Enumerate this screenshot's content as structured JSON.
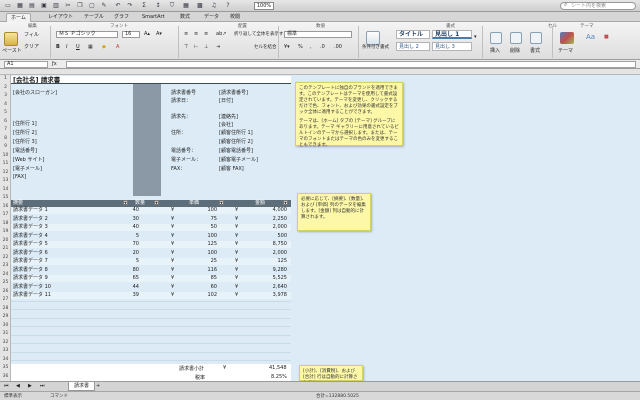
{
  "toolbar": {
    "zoom": "100%",
    "search_placeholder": "シート内を検索"
  },
  "ribbon_tabs": [
    "ホーム",
    "レイアウト",
    "テーブル",
    "グラフ",
    "SmartArt",
    "数式",
    "データ",
    "校閲"
  ],
  "ribbon": {
    "group_titles": [
      "編集",
      "フォント",
      "配置",
      "数値",
      "書式",
      "セル",
      "テーマ"
    ],
    "paste_label": "ペースト",
    "fill_label": "フィル",
    "clear_label": "クリア",
    "font_name": "ＭＳ Ｐゴシック",
    "font_size": "16",
    "wrap_label": "折り返して全体を表示する",
    "merge_label": "セルを結合",
    "number_format": "標準",
    "conditional_label": "条件付き書式",
    "style_title": "タイトル",
    "style_h1": "見出し 1",
    "style_h2": "見出し 2",
    "style_h3": "見出し 3",
    "insert_label": "挿入",
    "delete_label": "削除",
    "format_label": "書式",
    "theme_label": "テーマ",
    "aa_label": "Aa"
  },
  "formula_bar": {
    "cell_ref": "A1",
    "value": ""
  },
  "rows": [
    "1",
    "2",
    "3",
    "4",
    "5",
    "6",
    "7",
    "8",
    "9",
    "10",
    "11",
    "12",
    "13",
    "14",
    "15",
    "16",
    "17",
    "18",
    "19",
    "20",
    "21",
    "22",
    "23",
    "24",
    "25",
    "26",
    "27",
    "28",
    "29",
    "30",
    "31",
    "32",
    "33",
    "34",
    "35",
    "36"
  ],
  "invoice": {
    "title": "[会社名] 請求書",
    "slogan": "[会社のスローガン]",
    "address_lines": [
      "[住所行 1]",
      "[住所行 2]",
      "[住所行 3]",
      "[電話番号]",
      "[Web サイト]",
      "[電子メール]",
      "[FAX]"
    ],
    "info_labels": [
      "請求書番号",
      "請求日：",
      "",
      "請求先：",
      "",
      "住所：",
      "",
      "電話番号：",
      "電子メール：",
      "FAX："
    ],
    "info_values": [
      "[請求書番号]",
      "[日付]",
      "",
      "[連絡先]",
      "[会社]",
      "[顧客住所行 1]",
      "[顧客住所行 2]",
      "[顧客電話番号]",
      "[顧客電子メール]",
      "[顧客 FAX]"
    ],
    "table_headers": [
      "摘要",
      "数量",
      "単価",
      "金額"
    ],
    "items": [
      {
        "desc": "請求書データ 1",
        "qty": "40",
        "price": "100",
        "amount": "4,000"
      },
      {
        "desc": "請求書データ 2",
        "qty": "30",
        "price": "75",
        "amount": "2,250"
      },
      {
        "desc": "請求書データ 3",
        "qty": "40",
        "price": "50",
        "amount": "2,000"
      },
      {
        "desc": "請求書データ 4",
        "qty": "5",
        "price": "100",
        "amount": "500"
      },
      {
        "desc": "請求書データ 5",
        "qty": "70",
        "price": "125",
        "amount": "8,750"
      },
      {
        "desc": "請求書データ 6",
        "qty": "20",
        "price": "100",
        "amount": "2,000"
      },
      {
        "desc": "請求書データ 7",
        "qty": "5",
        "price": "25",
        "amount": "125"
      },
      {
        "desc": "請求書データ 8",
        "qty": "80",
        "price": "116",
        "amount": "9,280"
      },
      {
        "desc": "請求書データ 9",
        "qty": "65",
        "price": "85",
        "amount": "5,525"
      },
      {
        "desc": "請求書データ 10",
        "qty": "44",
        "price": "60",
        "amount": "2,640"
      },
      {
        "desc": "請求書データ 11",
        "qty": "39",
        "price": "102",
        "amount": "3,978"
      }
    ],
    "currency": "¥",
    "subtotal_label": "請求書小計",
    "subtotal_value": "41,548",
    "tax_label": "税率",
    "tax_value": "8.25%"
  },
  "notes": [
    "このテンプレートに独自のブランドを適用できます。このテンプレートはテーマを使用して書式設定されています。テーマを変更し、クリックするだけで色、フォント、および効果の書式設定をブック全体に適用することができます。",
    "テーマは、[ホーム] タブの [テーマ] グループにあります。テーマ ギャラリーに用意されているビルトインのテーマから選択します。または、テーマのフォントまたはテーマの色のみを変更することもできます。",
    "必要に応じて、[摘要]、[数量]、および [単価] 列のデータを編集します。[金額] 列は自動的に計算されます。",
    "[小計]、[消費税]、および [合計] 行は自動的に計算されます。"
  ],
  "sheet_tab": "請求書",
  "status": {
    "mode": "標準表示",
    "ready": "コマンド",
    "sum": "合計=132880.5025"
  }
}
